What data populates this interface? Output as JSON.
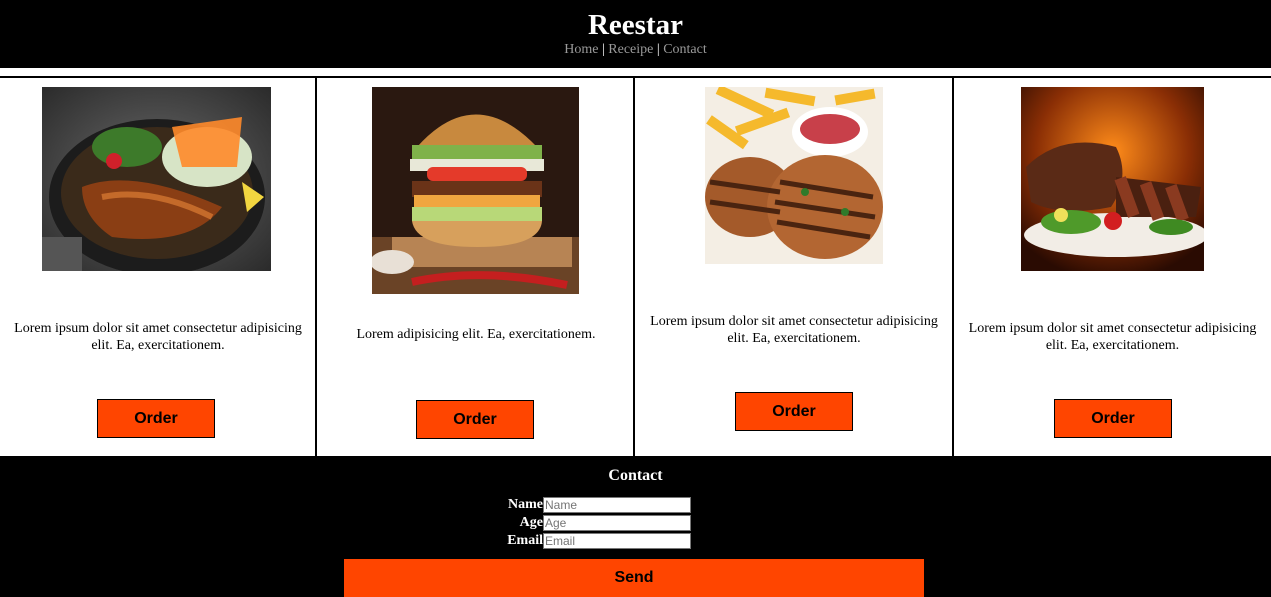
{
  "header": {
    "brand": "Reestar",
    "nav": [
      "Home",
      "Receipe",
      "Contact"
    ],
    "separator": "|"
  },
  "cards": [
    {
      "image": "teriyaki-chicken-salad-bowl",
      "description": "Lorem ipsum dolor sit amet consectetur adipisicing elit. Ea, exercitationem.",
      "button": "Order"
    },
    {
      "image": "cheeseburger-with-chili",
      "description": "Lorem adipisicing elit. Ea, exercitationem.",
      "button": "Order"
    },
    {
      "image": "grilled-patties-with-fries",
      "description": "Lorem ipsum dolor sit amet consectetur adipisicing elit. Ea, exercitationem.",
      "button": "Order"
    },
    {
      "image": "sliced-steak-with-salad",
      "description": "Lorem ipsum dolor sit amet consectetur adipisicing elit. Ea, exercitationem.",
      "button": "Order"
    }
  ],
  "contact": {
    "title": "Contact",
    "fields": [
      {
        "label": "Name",
        "placeholder": "Name"
      },
      {
        "label": "Age",
        "placeholder": "Age"
      },
      {
        "label": "Email",
        "placeholder": "Email"
      }
    ],
    "send": "Send"
  },
  "colors": {
    "accent": "#ff4500",
    "header_bg": "#000000",
    "nav_link": "#9a9a9a"
  }
}
